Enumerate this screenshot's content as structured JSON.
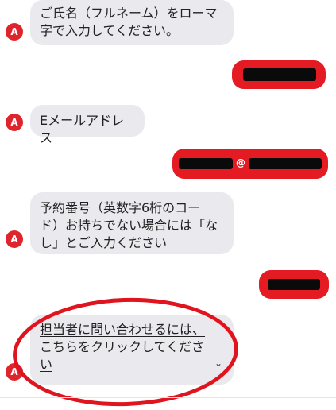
{
  "agent_initial": "A",
  "messages": [
    {
      "from": "agent",
      "lines": [
        "ご氏名（フルネーム）をローマ",
        "字で入力してください。"
      ]
    },
    {
      "from": "user",
      "redacted": true
    },
    {
      "from": "agent",
      "lines": [
        "Eメールアドレス"
      ]
    },
    {
      "from": "user",
      "redacted": true,
      "visible_char": "@"
    },
    {
      "from": "agent",
      "lines": [
        "予約番号（英数字6桁のコー",
        "ド）お持ちでない場合には「な",
        "し」とご入力ください"
      ]
    },
    {
      "from": "user",
      "redacted": true
    },
    {
      "from": "agent",
      "link": true,
      "lines": [
        "担当者に問い合わせるには、",
        "こちらをクリックしてくださ",
        "い"
      ]
    }
  ],
  "colors": {
    "agent_bubble": "#e9e9ee",
    "avatar": "#e0242c",
    "redaction_outline": "#e51b24",
    "highlight": "#e0141f"
  }
}
